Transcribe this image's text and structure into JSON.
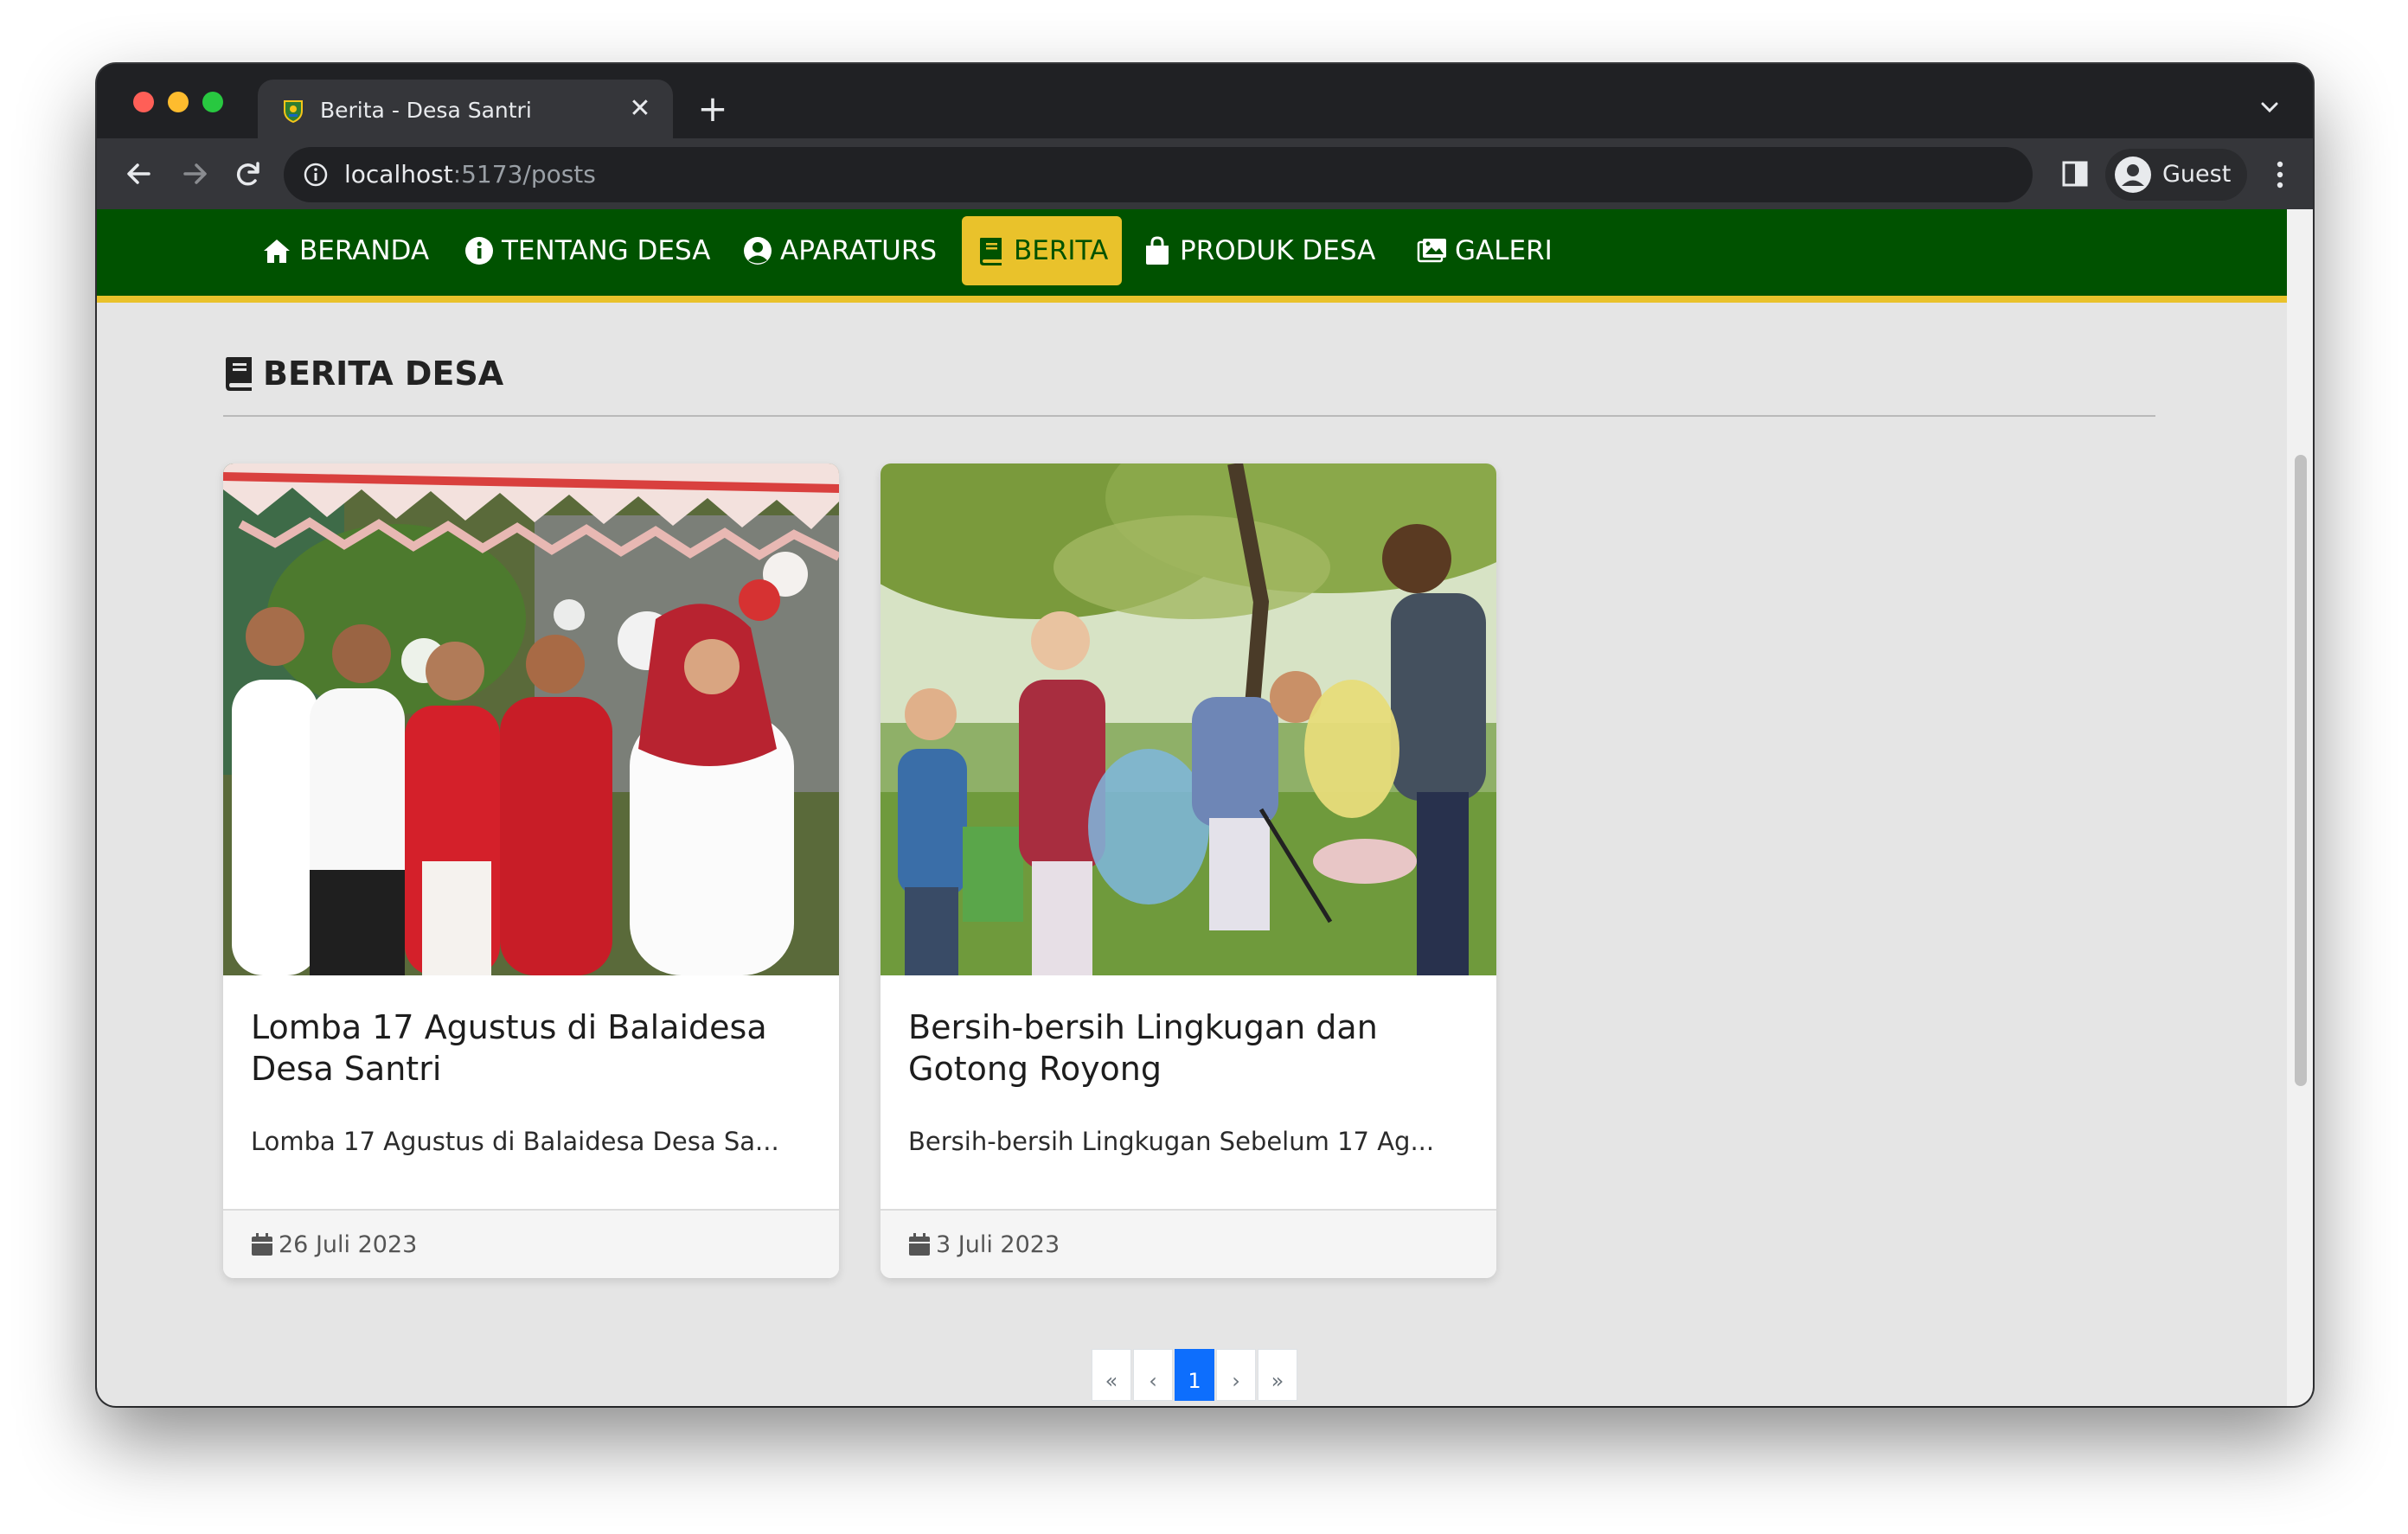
{
  "browser": {
    "tab_title": "Berita - Desa Santri",
    "tab_close": "✕",
    "new_tab": "+",
    "url_host": "localhost",
    "url_path": ":5173/posts",
    "profile_label": "Guest"
  },
  "nav": {
    "items": [
      {
        "label": "BERANDA",
        "icon": "home-icon"
      },
      {
        "label": "TENTANG DESA",
        "icon": "info-icon"
      },
      {
        "label": "APARATURS",
        "icon": "user-circle-icon"
      },
      {
        "label": "BERITA",
        "icon": "book-icon",
        "active": true
      },
      {
        "label": "PRODUK DESA",
        "icon": "shopping-bag-icon"
      },
      {
        "label": "GALERI",
        "icon": "images-icon"
      }
    ]
  },
  "page": {
    "heading": "BERITA DESA"
  },
  "posts": [
    {
      "title": "Lomba 17 Agustus di Balaidesa Desa Santri",
      "excerpt": "Lomba 17 Agustus di Balaidesa Desa Sa...",
      "date": "26 Juli 2023"
    },
    {
      "title": "Bersih-bersih Lingkugan dan Gotong Royong",
      "excerpt": "Bersih-bersih Lingkugan Sebelum 17 Ag...",
      "date": "3 Juli 2023"
    }
  ],
  "pagination": {
    "first": "«",
    "prev": "‹",
    "current": "1",
    "next": "›",
    "last": "»"
  },
  "colors": {
    "nav_bg": "#005200",
    "accent": "#e9c22b",
    "page_bg": "#e5e5e5",
    "pagination_active": "#0d6efd"
  }
}
